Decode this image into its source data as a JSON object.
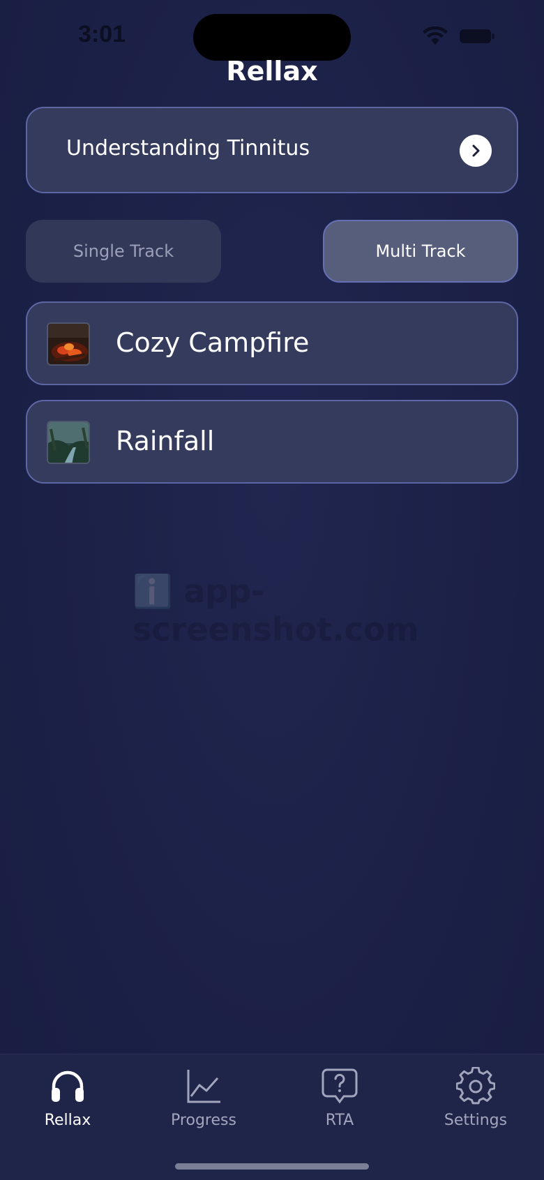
{
  "status_bar": {
    "time": "3:01"
  },
  "app": {
    "title": "Rellax"
  },
  "info_card": {
    "label": "Understanding Tinnitus"
  },
  "segments": {
    "single_label": "Single Track",
    "multi_label": "Multi Track",
    "selected": "Multi Track"
  },
  "tracks": [
    {
      "title": "Cozy Campfire",
      "thumb_icon": "campfire-thumbnail"
    },
    {
      "title": "Rainfall",
      "thumb_icon": "rainfall-thumbnail"
    }
  ],
  "watermark": "ℹ️ app-screenshot.com",
  "tab_bar": {
    "tabs": [
      {
        "label": "Rellax",
        "icon": "headphones-icon",
        "active": true
      },
      {
        "label": "Progress",
        "icon": "chart-line-icon",
        "active": false
      },
      {
        "label": "RTA",
        "icon": "question-bubble-icon",
        "active": false
      },
      {
        "label": "Settings",
        "icon": "gear-icon",
        "active": false
      }
    ]
  },
  "colors": {
    "background": "#1c2147",
    "card": "#353b5c",
    "card_border": "#5e66a6",
    "active_tab": "#ffffff",
    "inactive_tab": "#a1a6bc"
  }
}
